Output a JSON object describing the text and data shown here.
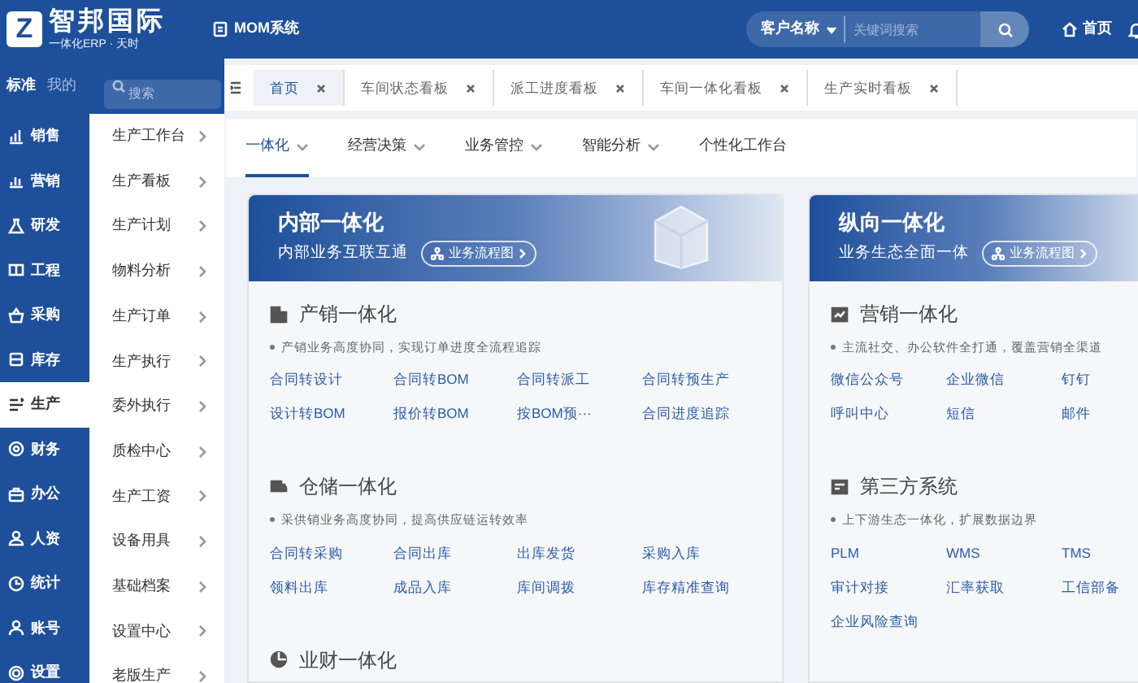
{
  "header": {
    "logo_mark": "Z",
    "logo_title": "智邦国际",
    "logo_subtitle": "一体化ERP · 天时",
    "system": "MOM系统",
    "search": {
      "scope": "客户名称",
      "placeholder": "关键词搜索"
    },
    "home": "首页"
  },
  "sidebar": {
    "tabs": [
      {
        "label": "标准",
        "selected": true
      },
      {
        "label": "我的",
        "selected": false
      }
    ],
    "search_placeholder": "搜索",
    "modules": [
      {
        "label": "销售",
        "selected": false
      },
      {
        "label": "营销",
        "selected": false
      },
      {
        "label": "研发",
        "selected": false
      },
      {
        "label": "工程",
        "selected": false
      },
      {
        "label": "采购",
        "selected": false
      },
      {
        "label": "库存",
        "selected": false
      },
      {
        "label": "生产",
        "selected": true
      },
      {
        "label": "财务",
        "selected": false
      },
      {
        "label": "办公",
        "selected": false
      },
      {
        "label": "人资",
        "selected": false
      },
      {
        "label": "统计",
        "selected": false
      },
      {
        "label": "账号",
        "selected": false
      },
      {
        "label": "设置",
        "selected": false
      }
    ],
    "submenu": [
      "生产工作台",
      "生产看板",
      "生产计划",
      "物料分析",
      "生产订单",
      "生产执行",
      "委外执行",
      "质检中心",
      "生产工资",
      "设备用具",
      "基础档案",
      "设置中心",
      "老版生产"
    ]
  },
  "tabs": [
    {
      "label": "首页",
      "selected": true
    },
    {
      "label": "车间状态看板",
      "selected": false
    },
    {
      "label": "派工进度看板",
      "selected": false
    },
    {
      "label": "车间一体化看板",
      "selected": false
    },
    {
      "label": "生产实时看板",
      "selected": false
    }
  ],
  "subnav": [
    {
      "label": "一体化",
      "selected": true,
      "dropdown": true
    },
    {
      "label": "经营决策",
      "selected": false,
      "dropdown": true
    },
    {
      "label": "业务管控",
      "selected": false,
      "dropdown": true
    },
    {
      "label": "智能分析",
      "selected": false,
      "dropdown": true
    },
    {
      "label": "个性化工作台",
      "selected": false,
      "dropdown": false
    }
  ],
  "cards": [
    {
      "title": "内部一体化",
      "subtitle": "内部业务互联互通",
      "button": "业务流程图",
      "sections": [
        {
          "title": "产销一体化",
          "description": "产销业务高度协同，实现订单进度全流程追踪",
          "links": [
            "合同转设计",
            "合同转BOM",
            "合同转派工",
            "合同转预生产",
            "设计转BOM",
            "报价转BOM",
            "按BOM预···",
            "合同进度追踪"
          ]
        },
        {
          "title": "仓储一体化",
          "description": "采供销业务高度协同，提高供应链运转效率",
          "links": [
            "合同转采购",
            "合同出库",
            "出库发货",
            "采购入库",
            "领料出库",
            "成品入库",
            "库间调拨",
            "库存精准查询"
          ]
        },
        {
          "title": "业财一体化"
        }
      ]
    },
    {
      "title": "纵向一体化",
      "subtitle": "业务生态全面一体",
      "button": "业务流程图",
      "sections": [
        {
          "title": "营销一体化",
          "description": "主流社交、办公软件全打通，覆盖营销全渠道",
          "links": [
            "微信公众号",
            "企业微信",
            "钉钉",
            "呼叫中心",
            "短信",
            "邮件"
          ]
        },
        {
          "title": "第三方系统",
          "description": "上下游生态一体化，扩展数据边界",
          "links": [
            "PLM",
            "WMS",
            "TMS",
            "审计对接",
            "汇率获取",
            "工信部备",
            "企业风险查询"
          ]
        }
      ]
    }
  ]
}
